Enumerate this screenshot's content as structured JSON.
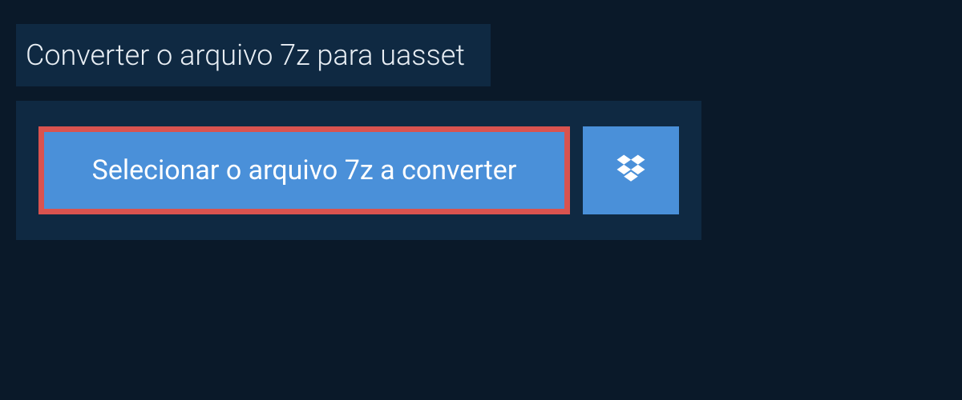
{
  "title": "Converter o arquivo 7z para uasset",
  "select_button": {
    "label": "Selecionar o arquivo 7z a converter"
  },
  "dropbox_button": {
    "icon_name": "dropbox-icon"
  },
  "colors": {
    "background": "#0a1929",
    "panel": "#0f2942",
    "button_bg": "#4a90d9",
    "button_border_highlight": "#d9534f",
    "text_light": "#e8eef4",
    "text_white": "#ffffff"
  }
}
